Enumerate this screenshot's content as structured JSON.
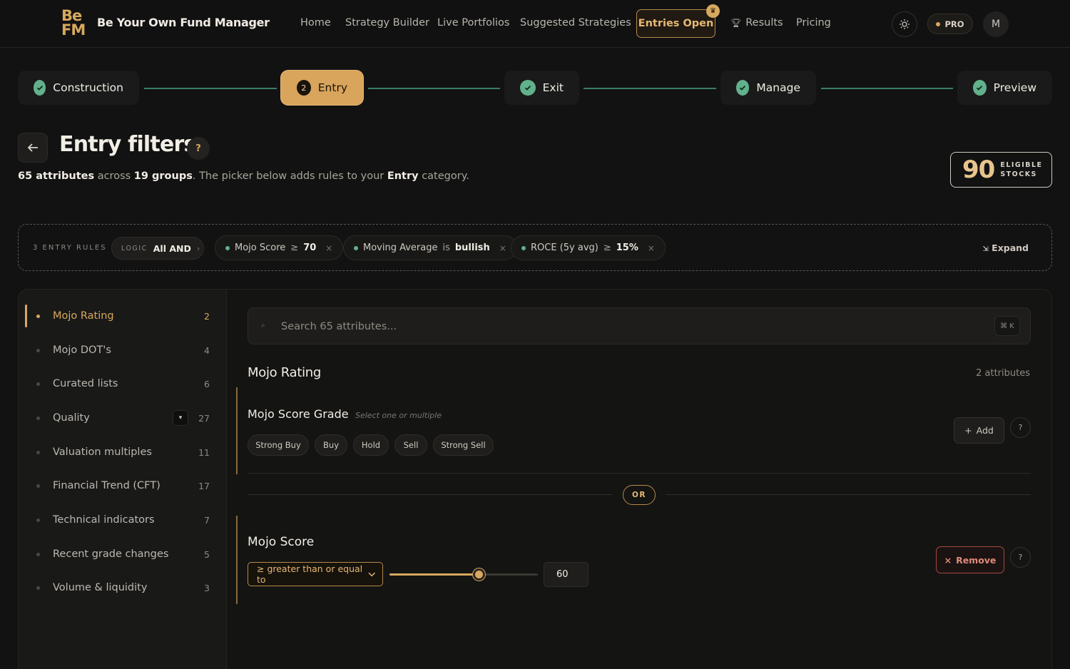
{
  "brand": {
    "logo_top": "Be",
    "logo_bottom": "FM",
    "name": "Be Your Own Fund Manager"
  },
  "nav": {
    "links": [
      "Home",
      "Strategy Builder",
      "Live Portfolios",
      "Suggested Strategies"
    ],
    "entries_label": "Entries Open",
    "results_label": "Results",
    "pricing_label": "Pricing",
    "pro_label": "PRO",
    "avatar_initial": "M"
  },
  "stepper": {
    "steps": [
      {
        "label": "Construction",
        "state": "done"
      },
      {
        "label": "Entry",
        "state": "active",
        "number": "2"
      },
      {
        "label": "Exit",
        "state": "done"
      },
      {
        "label": "Manage",
        "state": "done"
      },
      {
        "label": "Preview",
        "state": "done"
      }
    ]
  },
  "header": {
    "title": "Entry filters.",
    "help": "?",
    "attr_count": "65 attributes",
    "across": "across",
    "group_count": "19 groups",
    "picker_text": ". The picker below adds rules to your",
    "category": "Entry",
    "category_suffix": "category.",
    "eligible_count": "90",
    "eligible_line1": "ELIGIBLE",
    "eligible_line2": "STOCKS"
  },
  "rules": {
    "count_label": "3 ENTRY RULES",
    "logic_label": "LOGIC",
    "logic_value": "All AND",
    "chips": [
      {
        "name": "Mojo Score",
        "op": "≥",
        "value": "70"
      },
      {
        "name": "Moving Average",
        "op": "is",
        "value": "bullish"
      },
      {
        "name": "ROCE (5y avg)",
        "op": "≥",
        "value": "15%"
      }
    ],
    "expand_label": "Expand"
  },
  "sidebar": {
    "items": [
      {
        "label": "Mojo Rating",
        "count": "2"
      },
      {
        "label": "Mojo DOT's",
        "count": "4"
      },
      {
        "label": "Curated lists",
        "count": "6"
      },
      {
        "label": "Quality",
        "count": "27"
      },
      {
        "label": "Valuation multiples",
        "count": "11"
      },
      {
        "label": "Financial Trend (CFT)",
        "count": "17"
      },
      {
        "label": "Technical indicators",
        "count": "7"
      },
      {
        "label": "Recent grade changes",
        "count": "5"
      },
      {
        "label": "Volume & liquidity",
        "count": "3"
      }
    ]
  },
  "search": {
    "placeholder": "Search 65 attributes...",
    "shortcut": "⌘ K"
  },
  "group": {
    "title": "Mojo Rating",
    "count": "2 attributes",
    "grade": {
      "title": "Mojo Score Grade",
      "hint": "Select one or multiple",
      "options": [
        "Strong Buy",
        "Buy",
        "Hold",
        "Sell",
        "Strong Sell"
      ],
      "add_label": "Add"
    },
    "or_label": "OR",
    "score": {
      "title": "Mojo Score",
      "operator": "≥ greater than or equal to",
      "value": "60",
      "slider_fraction": 0.6,
      "remove_label": "Remove"
    }
  },
  "colors": {
    "accent": "#d7a85f",
    "success": "#62b18c",
    "danger": "#e0897b",
    "background": "#121212"
  }
}
